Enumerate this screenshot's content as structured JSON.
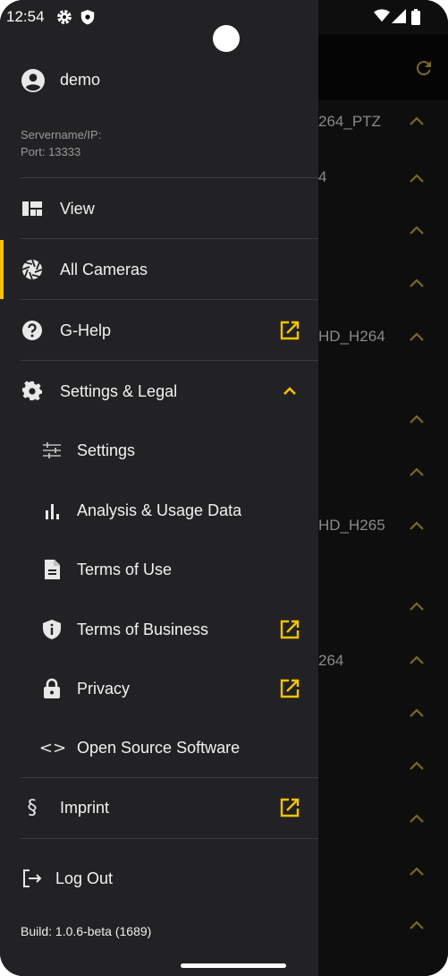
{
  "status": {
    "time": "12:54"
  },
  "background": {
    "labels": [
      "264_PTZ",
      "4",
      "HD_H264",
      "HD_H265",
      "264"
    ]
  },
  "user": {
    "name": "demo"
  },
  "server": {
    "servername_label": "Servername/IP:",
    "port_label": "Port: 13333"
  },
  "menu": {
    "view": "View",
    "all_cameras": "All Cameras",
    "g_help": "G-Help",
    "settings_legal": "Settings & Legal",
    "settings": "Settings",
    "analysis": "Analysis & Usage Data",
    "terms_of_use": "Terms of Use",
    "terms_of_business": "Terms of Business",
    "privacy": "Privacy",
    "open_source": "Open Source Software",
    "imprint": "Imprint",
    "imprint_symbol": "§",
    "open_source_symbol": "<>",
    "logout": "Log Out"
  },
  "build": "Build: 1.0.6-beta (1689)",
  "colors": {
    "accent": "#f3c300",
    "drawer_bg": "#222224",
    "bg": "#0e0e0e"
  }
}
